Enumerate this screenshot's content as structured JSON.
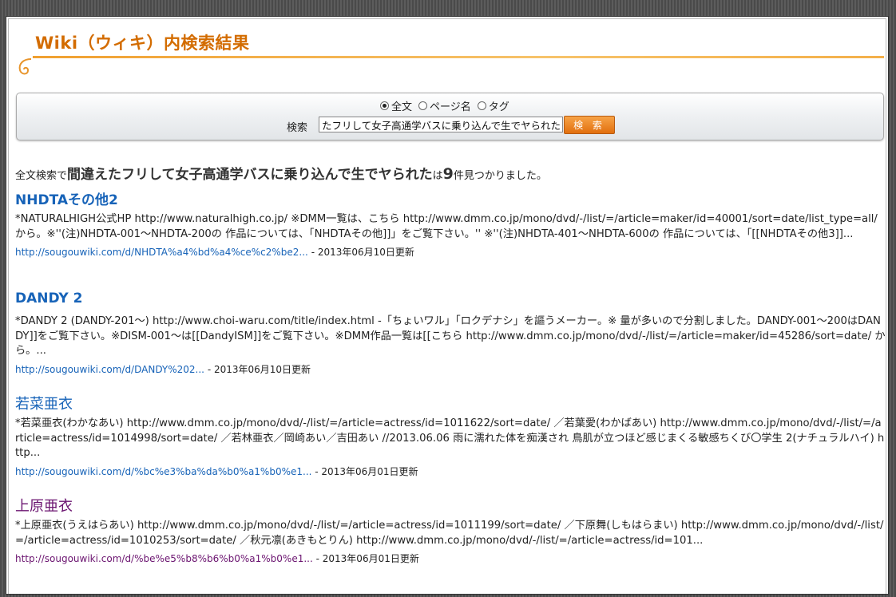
{
  "page": {
    "title": "Wiki（ウィキ）内検索結果"
  },
  "search": {
    "modes": [
      {
        "label": "全文",
        "checked": true
      },
      {
        "label": "ページ名",
        "checked": false
      },
      {
        "label": "タグ",
        "checked": false
      }
    ],
    "label": "検索",
    "value": "間違えたフリして女子高通学バスに乗り込んで生でヤられた",
    "button": "検 索"
  },
  "summary": {
    "prefix": "全文検索で",
    "query": "間違えたフリして女子高通学バスに乗り込んで生でヤられた",
    "middle": "は",
    "count": "9",
    "suffix": "件見つかりました。"
  },
  "results": [
    {
      "title": "NHDTAその他2",
      "snippet": "*NATURALHIGH公式HP http://www.naturalhigh.co.jp/ ※DMM一覧は、こちら http://www.dmm.co.jp/mono/dvd/-/list/=/article=maker/id=40001/sort=date/list_type=all/ から。※''(注)NHDTA-001～NHDTA-200の 作品については、「NHDTAその他]]」をご覧下さい。'' ※''(注)NHDTA-401～NHDTA-600の 作品については、「[[NHDTAその他3]]...",
      "url": "http://sougouwiki.com/d/NHDTA%a4%bd%a4%ce%c2%be2...",
      "date": "- 2013年06月10日更新",
      "visited": false
    },
    {
      "title": "DANDY 2",
      "snippet": "*DANDY 2 (DANDY-201～) http://www.choi-waru.com/title/index.html -「ちょいワル」「ロクデナシ」を謳うメーカー。※ 量が多いので分割しました。DANDY-001～200はDANDY]]をご覧下さい。※DISM-001～は[[DandyISM]]をご覧下さい。※DMM作品一覧は[[こちら http://www.dmm.co.jp/mono/dvd/-/list/=/article=maker/id=45286/sort=date/ から。...",
      "url": "http://sougouwiki.com/d/DANDY%202...",
      "date": "- 2013年06月10日更新",
      "visited": false
    },
    {
      "title": "若菜亜衣",
      "snippet": "*若菜亜衣(わかなあい) http://www.dmm.co.jp/mono/dvd/-/list/=/article=actress/id=1011622/sort=date/ ／若葉愛(わかばあい) http://www.dmm.co.jp/mono/dvd/-/list/=/article=actress/id=1014998/sort=date/ ／若林亜衣／岡崎あい／吉田あい //2013.06.06 雨に濡れた体を痴漢され 鳥肌が立つほど感じまくる敏感ちくび〇学生 2(ナチュラルハイ) http...",
      "url": "http://sougouwiki.com/d/%bc%e3%ba%da%b0%a1%b0%e1...",
      "date": "- 2013年06月01日更新",
      "visited": false
    },
    {
      "title": "上原亜衣",
      "snippet": "*上原亜衣(うえはらあい) http://www.dmm.co.jp/mono/dvd/-/list/=/article=actress/id=1011199/sort=date/ ／下原舞(しもはらまい) http://www.dmm.co.jp/mono/dvd/-/list/=/article=actress/id=1010253/sort=date/ ／秋元凛(あきもとりん) http://www.dmm.co.jp/mono/dvd/-/list/=/article=actress/id=101...",
      "url": "http://sougouwiki.com/d/%be%e5%b8%b6%b0%a1%b0%e1...",
      "date": "- 2013年06月01日更新",
      "visited": true
    }
  ]
}
